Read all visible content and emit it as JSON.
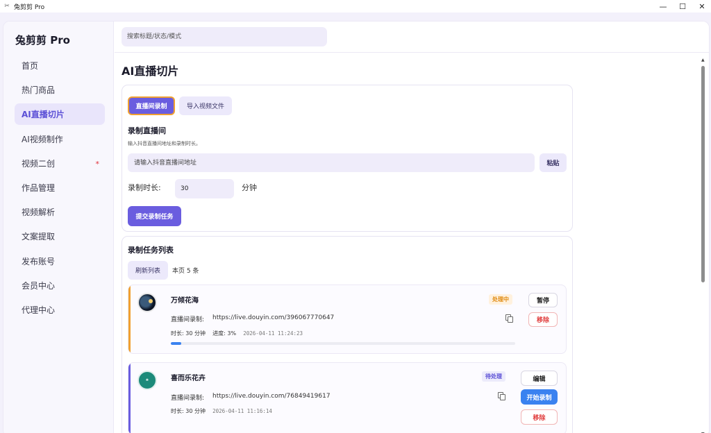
{
  "window": {
    "title": "兔剪剪 Pro",
    "minimize": "—",
    "maximize": "☐",
    "close": "✕"
  },
  "sidebar": {
    "brand": "兔剪剪 Pro",
    "items": [
      {
        "label": "首页"
      },
      {
        "label": "热门商品"
      },
      {
        "label": "AI直播切片",
        "active": true
      },
      {
        "label": "AI视频制作"
      },
      {
        "label": "视频二创",
        "dot": "*"
      },
      {
        "label": "作品管理"
      },
      {
        "label": "视频解析"
      },
      {
        "label": "文案提取"
      },
      {
        "label": "发布账号"
      },
      {
        "label": "会员中心"
      },
      {
        "label": "代理中心"
      }
    ]
  },
  "header": {
    "search_placeholder": "搜索标题/状态/模式"
  },
  "page": {
    "title": "AI直播切片"
  },
  "record": {
    "tab_live": "直播间录制",
    "tab_import": "导入视频文件",
    "section_title": "录制直播间",
    "section_desc": "输入抖音直播间地址和录制时长。",
    "url_placeholder": "请输入抖音直播间地址",
    "paste_label": "粘贴",
    "duration_label": "录制时长:",
    "duration_value": "30",
    "duration_unit": "分钟",
    "submit_label": "提交录制任务"
  },
  "tasks": {
    "title": "录制任务列表",
    "refresh_label": "刷新列表",
    "page_count": "本页 5 条",
    "items": [
      {
        "name": "万倾花海",
        "status": "处理中",
        "url_label": "直播间录制:",
        "url": "https://live.douyin.com/396067770647",
        "duration": "时长: 30 分钟",
        "progress_text": "进度: 3%",
        "progress": 0.03,
        "timestamp": "2026-04-11 11:24:23",
        "actions": [
          "暂停",
          "移除"
        ]
      },
      {
        "name": "喜而乐花卉",
        "status": "待处理",
        "url_label": "直播间录制:",
        "url": "https://live.douyin.com/76849419617",
        "duration": "时长: 30 分钟",
        "timestamp": "2026-04-11 11:16:14",
        "actions": [
          "编辑",
          "开始录制",
          "移除"
        ]
      }
    ]
  },
  "colors": {
    "accent": "#6a5ddf",
    "processing": "#f0a030",
    "blue": "#3a82f0",
    "danger": "#e03a3a"
  }
}
